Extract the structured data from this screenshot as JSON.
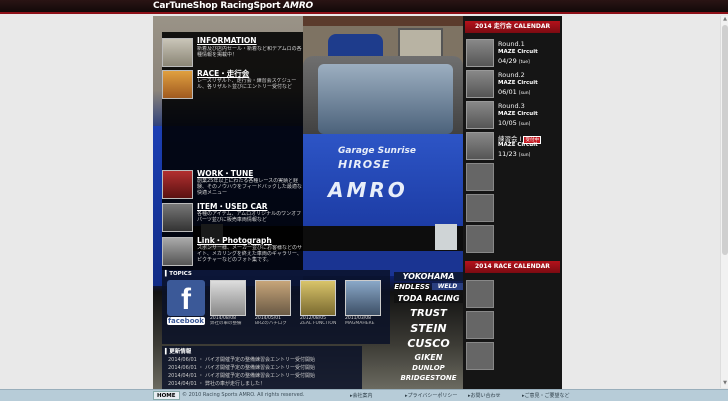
{
  "header": {
    "logo_text": "CarTuneShop RacingSport",
    "logo_brand": "AMRO"
  },
  "photo": {
    "stickers": [
      "Garage Sunrise",
      "HIROSE",
      "AMRO"
    ]
  },
  "menu": [
    {
      "title": "INFORMATION",
      "desc": "新着及び店内セール・新着など和デアムロの各種情報を掲載中！"
    },
    {
      "title": "RACE・走行会",
      "desc": "レースリザルト、走行会・練習会スケジュール、各リザルト並びにエントリー受付など"
    },
    {
      "title": "WORK・TUNE",
      "desc": "創業25年以上にわたる各種レースの実績と経験、そのノウハウをフィードバックした最適な快適メニュー"
    },
    {
      "title": "ITEM・USED CAR",
      "desc": "各種のアイテム、アムロオリジナルのワンオフパーツ並びに販売車両情報など"
    },
    {
      "title": "Link・Photograph",
      "desc": "スポンサー様、メーカー並びにお客様などのサイト、メカリングを終えた車両のギャラリー、ピクチャーなどのフォト集です。"
    }
  ],
  "topics": {
    "heading": "TOPICS",
    "facebook_label": "facebook",
    "items": [
      {
        "date": "2014/08/08",
        "title": "弊社の車の整備"
      },
      {
        "date": "2014/05/01",
        "title": "BRZのハチロク"
      },
      {
        "date": "2012/08/05",
        "title": "ZEAL FUNCTION"
      },
      {
        "date": "2011/03/08",
        "title": "MAGMAHERE"
      }
    ]
  },
  "news": {
    "heading": "更新情報",
    "items": [
      {
        "date": "2014/06/01",
        "text": "バイオ開催予定の整備練習会エントリー受付開始"
      },
      {
        "date": "2014/06/01",
        "text": "バイオ開催予定の整備練習会エントリー受付開始"
      },
      {
        "date": "2014/04/01",
        "text": "バイオ開催予定の整備練習会エントリー受付開始"
      },
      {
        "date": "2014/04/01",
        "text": "弊社の車が走行しました！"
      }
    ]
  },
  "sponsors": [
    "YOKOHAMA",
    "ENDLESS",
    "WELD",
    "TODA RACING",
    "TRUST",
    "STEIN",
    "CUSCO",
    "GIKEN",
    "DUNLOP",
    "BRIDGESTONE"
  ],
  "calendar": {
    "heading": "2014 走行会 CALENDAR",
    "rounds": [
      {
        "round": "Round.1",
        "place": "MAZE Circuit",
        "date": "04/29",
        "day": "tue",
        "badge": ""
      },
      {
        "round": "Round.2",
        "place": "MAZE Circuit",
        "date": "06/01",
        "day": "sun",
        "badge": ""
      },
      {
        "round": "Round.3",
        "place": "MAZE Circuit",
        "date": "10/05",
        "day": "sun",
        "badge": ""
      },
      {
        "round": "練習会 I",
        "place": "MAZE Circuit",
        "date": "11/23",
        "day": "sun",
        "badge": "受付中"
      }
    ],
    "race_heading": "2014 RACE CALENDAR"
  },
  "footer": {
    "home": "HOME",
    "copyright": "© 2010 Racing Sports AMRO. All rights reserved.",
    "links": [
      "会社案内",
      "プライバシーポリシー",
      "お問い合わせ",
      "ご意見・ご要望など"
    ]
  },
  "colors": {
    "accent": "#b5121b",
    "header_bg": "#1a0c0c",
    "footer_bg": "#b7ccd8"
  }
}
